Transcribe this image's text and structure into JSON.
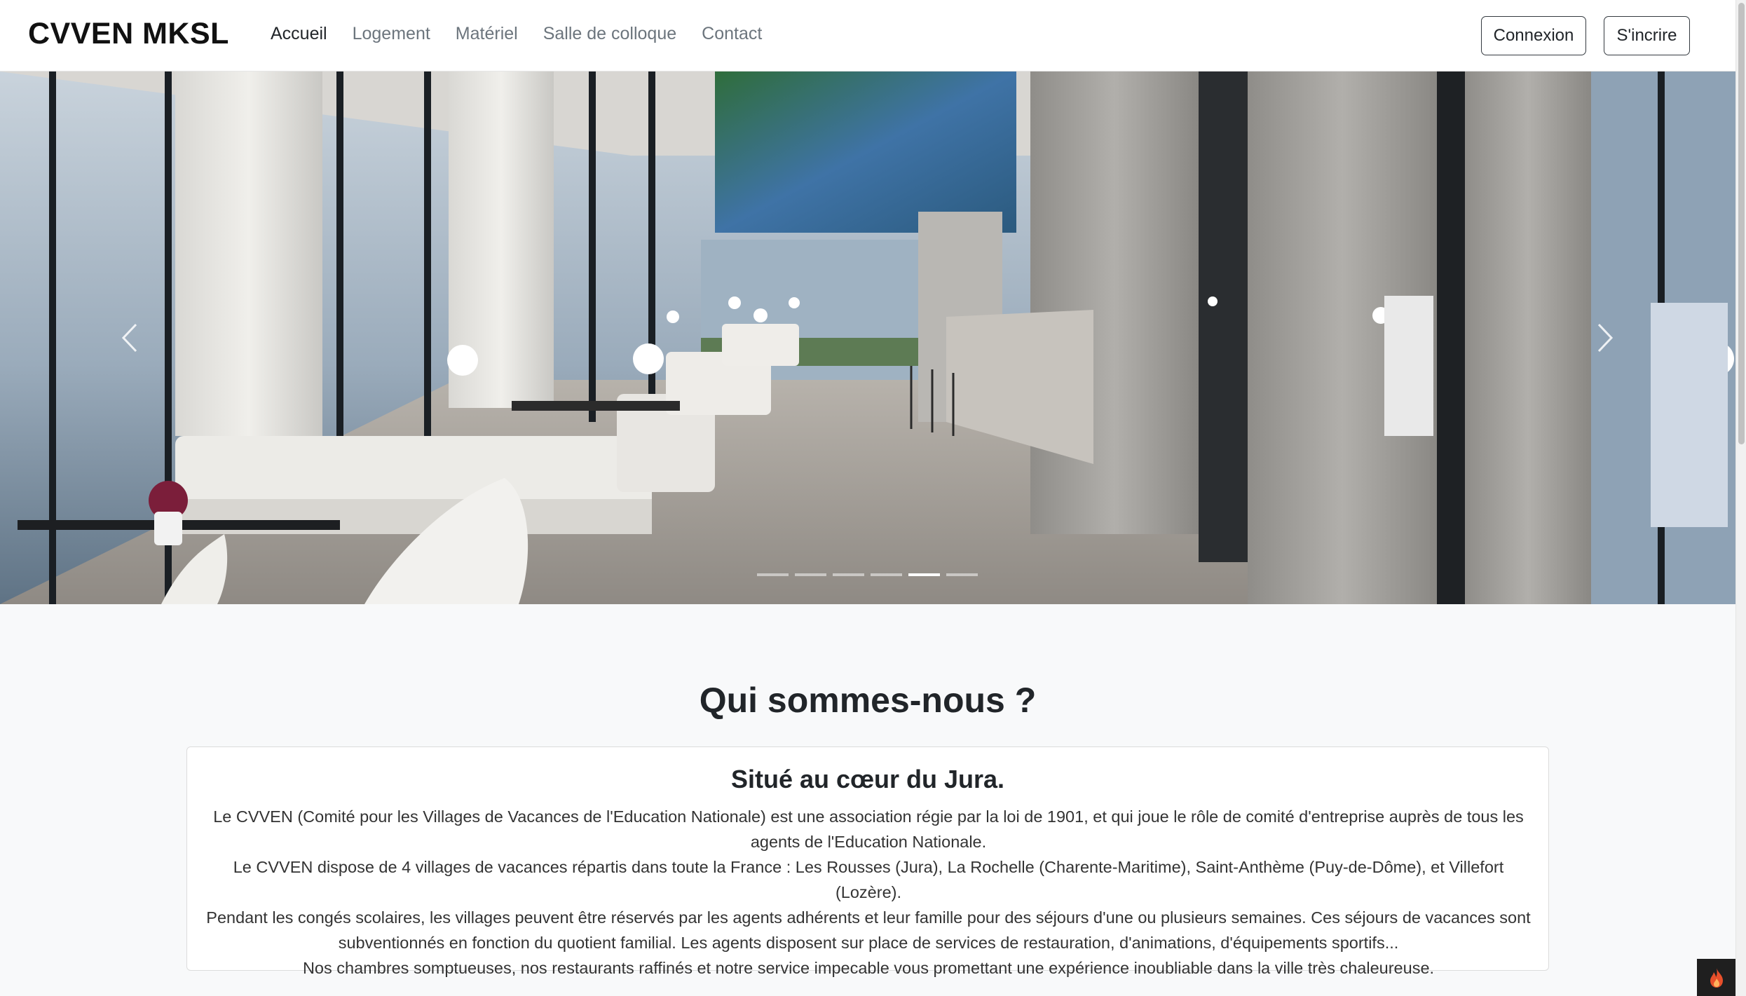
{
  "navbar": {
    "brand": "CVVEN MKSL",
    "links": [
      {
        "label": "Accueil",
        "active": true
      },
      {
        "label": "Logement",
        "active": false
      },
      {
        "label": "Matériel",
        "active": false
      },
      {
        "label": "Salle de colloque",
        "active": false
      },
      {
        "label": "Contact",
        "active": false
      }
    ],
    "login_label": "Connexion",
    "signup_label": "S'incrire"
  },
  "carousel": {
    "slide_count": 6,
    "active_index": 4,
    "image_subject": "luxury hotel lounge interior with sea view",
    "prev_icon": "chevron-left-icon",
    "next_icon": "chevron-right-icon"
  },
  "about": {
    "section_title": "Qui sommes-nous ?",
    "card_title": "Situé au cœur du Jura.",
    "paragraphs": [
      "Le CVVEN (Comité pour les Villages de Vacances de l'Education Nationale) est une association régie par la loi de 1901, et qui joue le rôle de comité d'entreprise auprès de tous les agents de l'Education Nationale.",
      "Le CVVEN dispose de 4 villages de vacances répartis dans toute la France : Les Rousses (Jura), La Rochelle (Charente-Maritime), Saint-Anthème (Puy-de-Dôme), et Villefort (Lozère).",
      "Pendant les congés scolaires, les villages peuvent être réservés par les agents adhérents et leur famille pour des séjours d'une ou plusieurs semaines. Ces séjours de vacances sont subventionnés en fonction du quotient familial. Les agents disposent sur place de services de restauration, d'animations, d'équipements sportifs...",
      "Nos chambres somptueuses, nos restaurants raffinés et notre service impecable vous promettant une expérience inoubliable dans la ville très chaleureuse."
    ]
  },
  "corner_widget": {
    "icon": "flame-icon"
  },
  "colors": {
    "page_bg": "#f8f9fa",
    "navbar_bg": "#ffffff",
    "text": "#212529",
    "muted": "#6c757d"
  }
}
